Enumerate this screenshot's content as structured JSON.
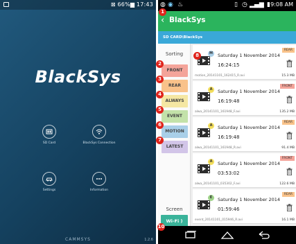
{
  "home": {
    "status_right": "⊠ 66%▆ 17:43",
    "logo": "BlackSys",
    "icons": [
      {
        "label": "SD Card",
        "icon": "sd-card-icon"
      },
      {
        "label": "BlackSys Connection",
        "icon": "wifi-icon"
      },
      {
        "label": "Settings",
        "icon": "car-icon"
      },
      {
        "label": "Information",
        "icon": "more-icon"
      }
    ],
    "brand": "CAMMSYS",
    "version": "1.2.6"
  },
  "app": {
    "time": "9:08 AM",
    "title": "BlackSys",
    "back": "‹",
    "path": "SD CARD\\BlackSys",
    "sorting_label": "Sorting",
    "sort_buttons": [
      {
        "label": "FRONT",
        "color": "#f4a49a"
      },
      {
        "label": "REAR",
        "color": "#f9c28a"
      },
      {
        "label": "ALWAYS",
        "color": "#f5e7a3"
      },
      {
        "label": "EVENT",
        "color": "#c3e2a9"
      },
      {
        "label": "MOTION",
        "color": "#a9cfe8"
      },
      {
        "label": "LATEST",
        "color": "#d2c5e8"
      }
    ],
    "screen_label": "Screen",
    "wifi_label": "Wi-Fi )",
    "files": [
      {
        "tag": "REAR",
        "tag_color": "#f9c28a",
        "badge": "M",
        "badge_color": "#a9cfe8",
        "date": "Saturday 1 November 2014",
        "time": "16:24:15",
        "name": "motion_20141101_162415_R.avi",
        "size": "15.3 MB"
      },
      {
        "tag": "FRONT",
        "tag_color": "#f4a49a",
        "badge": "A",
        "badge_color": "#f3de5c",
        "date": "Saturday 1 November 2014",
        "time": "16:19:48",
        "name": "alwa_20141101_161948_F.avi",
        "size": "135.2 MB"
      },
      {
        "tag": "REAR",
        "tag_color": "#f9c28a",
        "badge": "A",
        "badge_color": "#f3de5c",
        "date": "Saturday 1 November 2014",
        "time": "16:19:48",
        "name": "alwa_20141101_161948_R.avi",
        "size": "91.4 MB"
      },
      {
        "tag": "FRONT",
        "tag_color": "#f4a49a",
        "badge": "A",
        "badge_color": "#f3de5c",
        "date": "Saturday 1 November 2014",
        "time": "03:53:02",
        "name": "alwa_20141101_035302_F.avi",
        "size": "122.6 MB"
      },
      {
        "tag": "REAR",
        "tag_color": "#f9c28a",
        "badge": "E",
        "badge_color": "#9fd38a",
        "date": "Saturday 1 November 2014",
        "time": "01:59:46",
        "name": "event_20141101_015946_R.avi",
        "size": "16.1 MB"
      }
    ]
  },
  "callouts": [
    "1",
    "2",
    "3",
    "4",
    "5",
    "6",
    "7",
    "8",
    "10"
  ],
  "colors": {
    "accent_green": "#2bb45d",
    "path_blue": "#3aa8d8",
    "callout_red": "#e0231b",
    "wifi_teal": "#3ab39a"
  }
}
